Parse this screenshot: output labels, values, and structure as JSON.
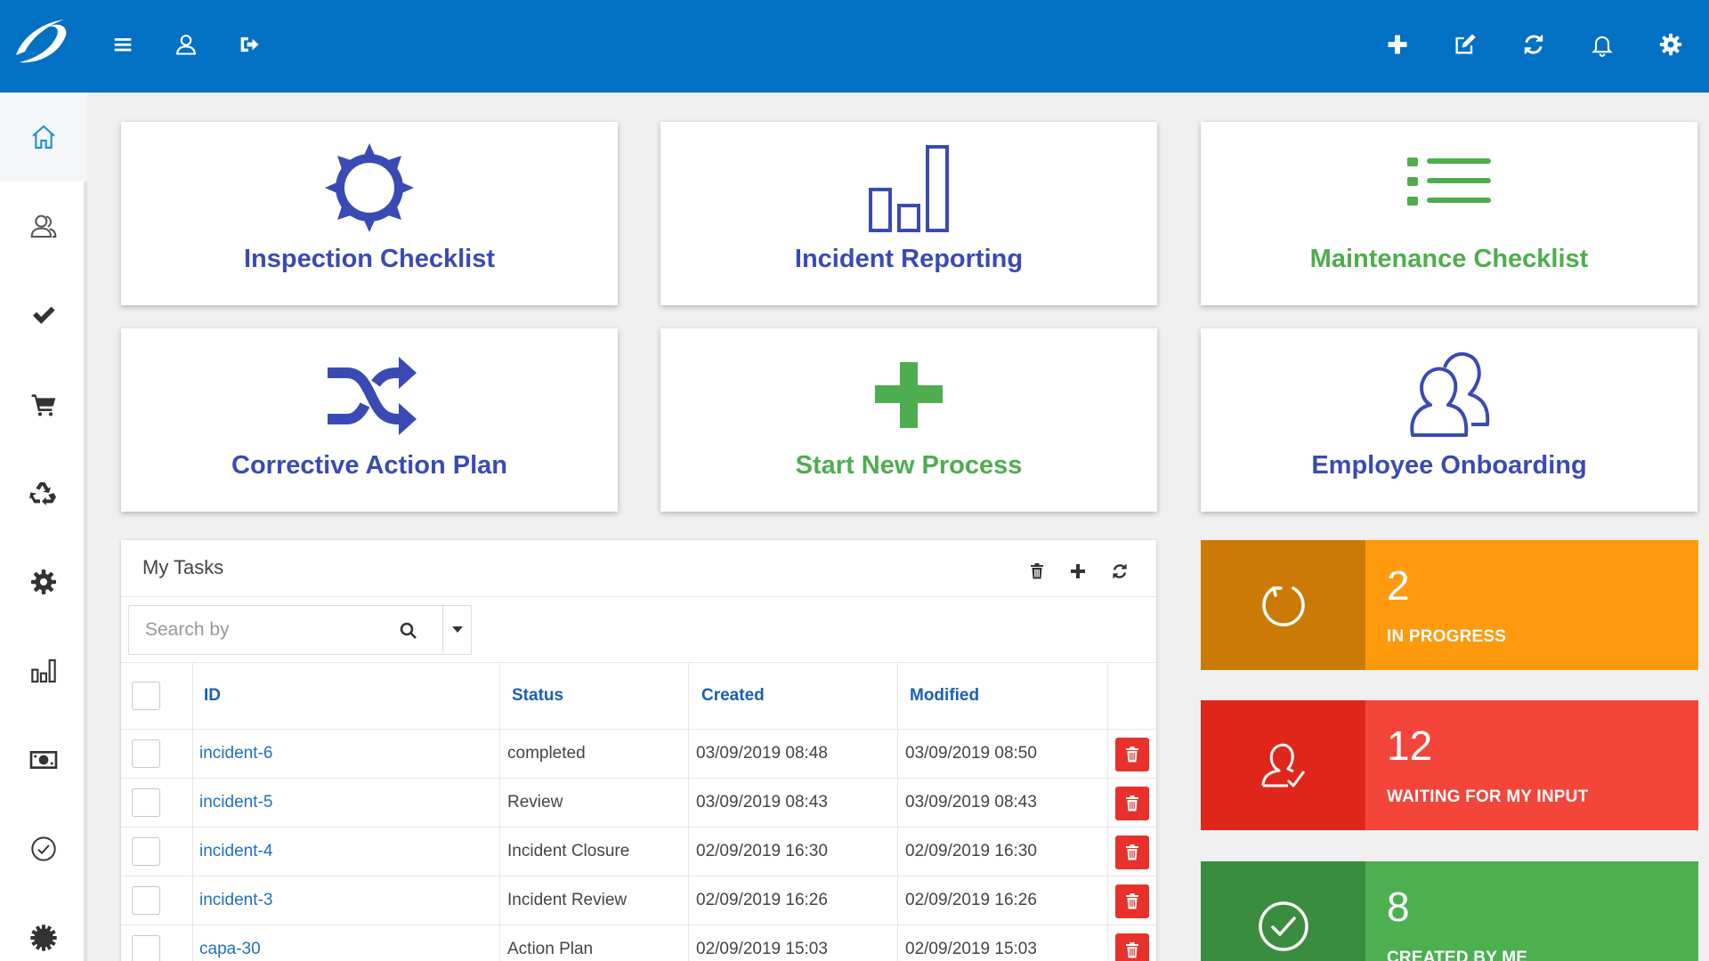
{
  "topbar": {
    "left_icons": [
      "menu-icon",
      "user-icon",
      "sign-out-icon"
    ],
    "right_icons": [
      "plus-icon",
      "edit-icon",
      "refresh-icon",
      "bell-icon",
      "gear-icon"
    ]
  },
  "sidebar": {
    "items": [
      {
        "icon": "home-icon",
        "active": true
      },
      {
        "icon": "users-icon"
      },
      {
        "icon": "check-icon"
      },
      {
        "icon": "cart-icon"
      },
      {
        "icon": "recycle-icon"
      },
      {
        "icon": "gear-icon"
      },
      {
        "icon": "bar-chart-icon"
      },
      {
        "icon": "money-icon"
      },
      {
        "icon": "check-circle-icon"
      },
      {
        "icon": "cog-icon"
      }
    ]
  },
  "tiles": [
    {
      "label": "Inspection Checklist",
      "icon": "sun-icon",
      "color": "#3a4ab4"
    },
    {
      "label": "Incident Reporting",
      "icon": "bar-chart-icon",
      "color": "#3a4ab4"
    },
    {
      "label": "Maintenance Checklist",
      "icon": "list-icon",
      "color": "#4ead4e"
    },
    {
      "label": "Corrective Action Plan",
      "icon": "shuffle-icon",
      "color": "#3a4ab4"
    },
    {
      "label": "Start New Process",
      "icon": "plus-icon",
      "color": "#4ead4e"
    },
    {
      "label": "Employee Onboarding",
      "icon": "users-icon",
      "color": "#3a4ab4"
    }
  ],
  "tasks": {
    "title": "My Tasks",
    "toolbar_icons": [
      "trash-icon",
      "plus-icon",
      "refresh-icon"
    ],
    "search_placeholder": "Search by",
    "columns": [
      "ID",
      "Status",
      "Created",
      "Modified"
    ],
    "rows": [
      {
        "id": "incident-6",
        "status": "completed",
        "created": "03/09/2019 08:48",
        "modified": "03/09/2019 08:50"
      },
      {
        "id": "incident-5",
        "status": "Review",
        "created": "03/09/2019 08:43",
        "modified": "03/09/2019 08:43"
      },
      {
        "id": "incident-4",
        "status": "Incident Closure",
        "created": "02/09/2019 16:30",
        "modified": "02/09/2019 16:30"
      },
      {
        "id": "incident-3",
        "status": "Incident Review",
        "created": "02/09/2019 16:26",
        "modified": "02/09/2019 16:26"
      },
      {
        "id": "capa-30",
        "status": "Action Plan",
        "created": "02/09/2019 15:03",
        "modified": "02/09/2019 15:03"
      }
    ]
  },
  "stats": [
    {
      "value": "2",
      "label": "IN PROGRESS",
      "icon": "spinner-icon",
      "dark": "#cc7a06",
      "light": "#ff9a0f"
    },
    {
      "value": "12",
      "label": "WAITING FOR MY INPUT",
      "icon": "user-check-icon",
      "dark": "#e0261b",
      "light": "#f4453a"
    },
    {
      "value": "8",
      "label": "CREATED BY ME",
      "icon": "check-circle-icon",
      "dark": "#3a8c3e",
      "light": "#4caf50"
    }
  ],
  "colors": {
    "topbar": "#0271c4",
    "accent_blue": "#3a4ab4",
    "accent_green": "#4ead4e",
    "link": "#1f6fc2",
    "delete": "#e8312a"
  }
}
